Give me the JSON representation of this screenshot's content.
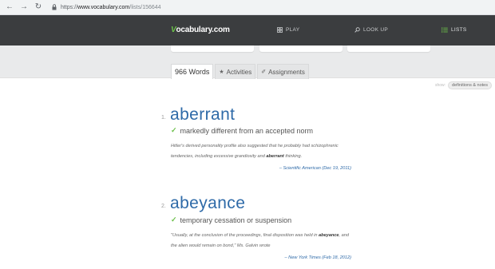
{
  "browser": {
    "url_proto": "https://",
    "url_host": "www.vocabulary.com",
    "url_path": "/lists/156644"
  },
  "topnav": {
    "logo_v": "V",
    "logo_rest": "ocabulary.com",
    "play": "PLAY",
    "lookup": "LOOK UP",
    "lists": "LISTS"
  },
  "tabs": {
    "words": "966 Words",
    "activities": "Activities",
    "assignments": "Assignments"
  },
  "toggle": {
    "label": "show:",
    "value": "definitions & notes"
  },
  "entries": [
    {
      "num": "1.",
      "word": "aberrant",
      "definition": "markedly different from an accepted norm",
      "example_before": "Hitler's derived personality profile also suggested that he probably had schizophrenic tendencies, including excessive grandiosity and ",
      "example_bold": "aberrant",
      "example_after": " thinking.",
      "source": "– Scientific American (Dec 19, 2011)"
    },
    {
      "num": "2.",
      "word": "abeyance",
      "definition": "temporary cessation or suspension",
      "example_before": "\"Usually, at the conclusion of the proceedings, final disposition was held in ",
      "example_bold": "abeyance",
      "example_after": ", and the alien would remain on bond,\" Ms. Galvin wrote",
      "source": "– New York Times (Feb 18, 2012)"
    }
  ],
  "colors": {
    "topbar": "#3b3d3f",
    "accent_green": "#6cc04a",
    "word_blue": "#2e6aa8",
    "band": "#e9eaeb"
  }
}
